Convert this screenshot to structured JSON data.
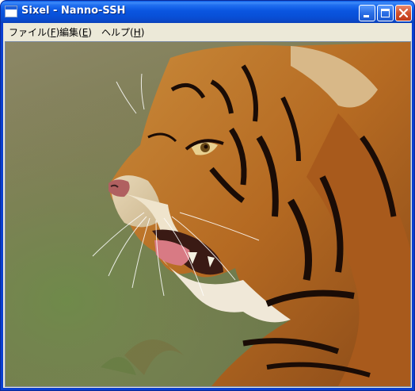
{
  "window": {
    "title": "Sixel - Nanno-SSH",
    "icon": "terminal-window-icon",
    "controls": [
      "minimize-icon",
      "maximize-icon",
      "close-icon"
    ],
    "title_color": "#0a55e0",
    "close_color": "#d2512c"
  },
  "menu": {
    "file": {
      "label": "ファイル(",
      "mnemonic": "F",
      "suffix": ")"
    },
    "edit": {
      "label": "編集(",
      "mnemonic": "E",
      "suffix": ")"
    },
    "help": {
      "label": "ヘルプ(",
      "mnemonic": "H",
      "suffix": ")"
    }
  },
  "content": {
    "image_subject": "tiger-photo"
  }
}
